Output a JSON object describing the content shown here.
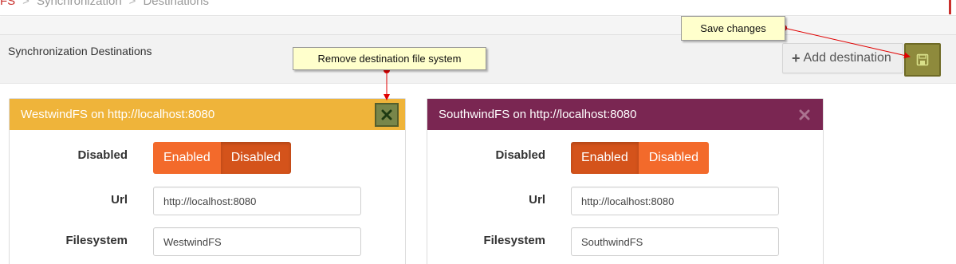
{
  "breadcrumb": {
    "root": "FS",
    "items": [
      "Synchronization",
      "Destinations"
    ],
    "separator": ">"
  },
  "header": {
    "title": "Synchronization Destinations",
    "add_button_label": "Add destination"
  },
  "callouts": {
    "save": "Save changes",
    "remove": "Remove destination file system"
  },
  "destinations": [
    {
      "title": "WestwindFS on http://localhost:8080",
      "header_color": "#efb43a",
      "disabled_label": "Disabled",
      "toggle": {
        "enabled": "Enabled",
        "disabled": "Disabled",
        "selected": "Disabled"
      },
      "url_label": "Url",
      "url_value": "http://localhost:8080",
      "filesystem_label": "Filesystem",
      "filesystem_value": "WestwindFS"
    },
    {
      "title": "SouthwindFS on http://localhost:8080",
      "header_color": "#7a2652",
      "disabled_label": "Disabled",
      "toggle": {
        "enabled": "Enabled",
        "disabled": "Disabled",
        "selected": "Enabled"
      },
      "url_label": "Url",
      "url_value": "http://localhost:8080",
      "filesystem_label": "Filesystem",
      "filesystem_value": "SouthwindFS"
    }
  ],
  "colors": {
    "accent_red": "#c9302c",
    "toggle_orange": "#f36a2b",
    "save_button": "#8e8a3c",
    "callout_bg": "#ffffcc"
  },
  "icons": {
    "add": "plus-icon",
    "save": "floppy-disk-icon",
    "remove": "close-icon"
  }
}
